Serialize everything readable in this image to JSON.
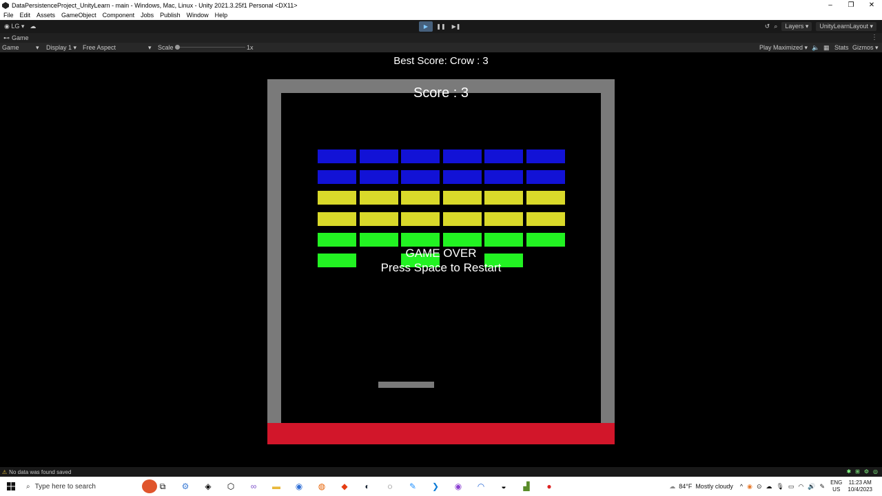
{
  "window": {
    "title": "DataPersistenceProject_UnityLearn - main - Windows, Mac, Linux - Unity 2021.3.25f1 Personal <DX11>"
  },
  "menu": [
    "File",
    "Edit",
    "Assets",
    "GameObject",
    "Component",
    "Jobs",
    "Publish",
    "Window",
    "Help"
  ],
  "toolbar": {
    "account": "LG",
    "layers": "Layers",
    "layout": "UnityLearnLayout"
  },
  "tab": {
    "label": "Game"
  },
  "game_toolbar": {
    "mode": "Game",
    "display": "Display 1",
    "aspect": "Free Aspect",
    "scale_label": "Scale",
    "scale_value": "1x",
    "play_mode": "Play Maximized",
    "stats": "Stats",
    "gizmos": "Gizmos"
  },
  "game": {
    "best_score": "Best Score: Crow : 3",
    "score": "Score : 3",
    "game_over": "GAME OVER",
    "restart": "Press Space to Restart",
    "colors": {
      "blue": "#1212d6",
      "yellow": "#d9d92a",
      "green": "#22f222",
      "wall": "#7a7a7a",
      "deadzone": "#d2162a"
    },
    "brick_rows": [
      [
        "blue",
        "blue",
        "blue",
        "blue",
        "blue",
        "blue"
      ],
      [
        "blue",
        "blue",
        "blue",
        "blue",
        "blue",
        "blue"
      ],
      [
        "yellow",
        "yellow",
        "yellow",
        "yellow",
        "yellow",
        "yellow"
      ],
      [
        "yellow",
        "yellow",
        "yellow",
        "yellow",
        "yellow",
        "yellow"
      ],
      [
        "green",
        "green",
        "green",
        "green",
        "green",
        "green"
      ],
      [
        "green",
        "",
        "green",
        "",
        "green",
        ""
      ]
    ]
  },
  "status": {
    "message": "No data was found saved"
  },
  "taskbar": {
    "search_placeholder": "Type here to search",
    "weather_temp": "84°F",
    "weather_desc": "Mostly cloudy",
    "lang_top": "ENG",
    "lang_bottom": "US",
    "time": "11:23 AM",
    "date": "10/4/2023"
  }
}
